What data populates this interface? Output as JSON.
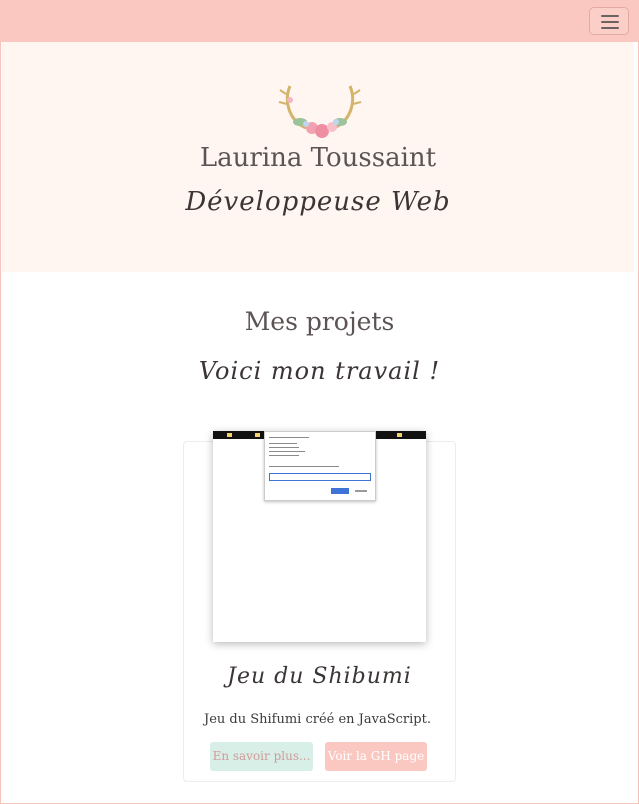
{
  "hero": {
    "name": "Laurina Toussaint",
    "role": "Développeuse Web",
    "logo_icon": "floral-antlers-logo"
  },
  "projects": {
    "title": "Mes projets",
    "subtitle": "Voici mon travail !"
  },
  "card": {
    "title": "Jeu du Shibumi",
    "description": "Jeu du Shifumi créé en JavaScript.",
    "more_button": "En savoir plus...",
    "gh_button": "Voir la GH page"
  },
  "navbar": {
    "menu_icon": "hamburger-menu-icon"
  },
  "colors": {
    "navbar": "#fac8c1",
    "hero_bg": "#fff5f1",
    "button_more_bg": "#d8efe8",
    "button_gh_bg": "#fac8c1"
  }
}
